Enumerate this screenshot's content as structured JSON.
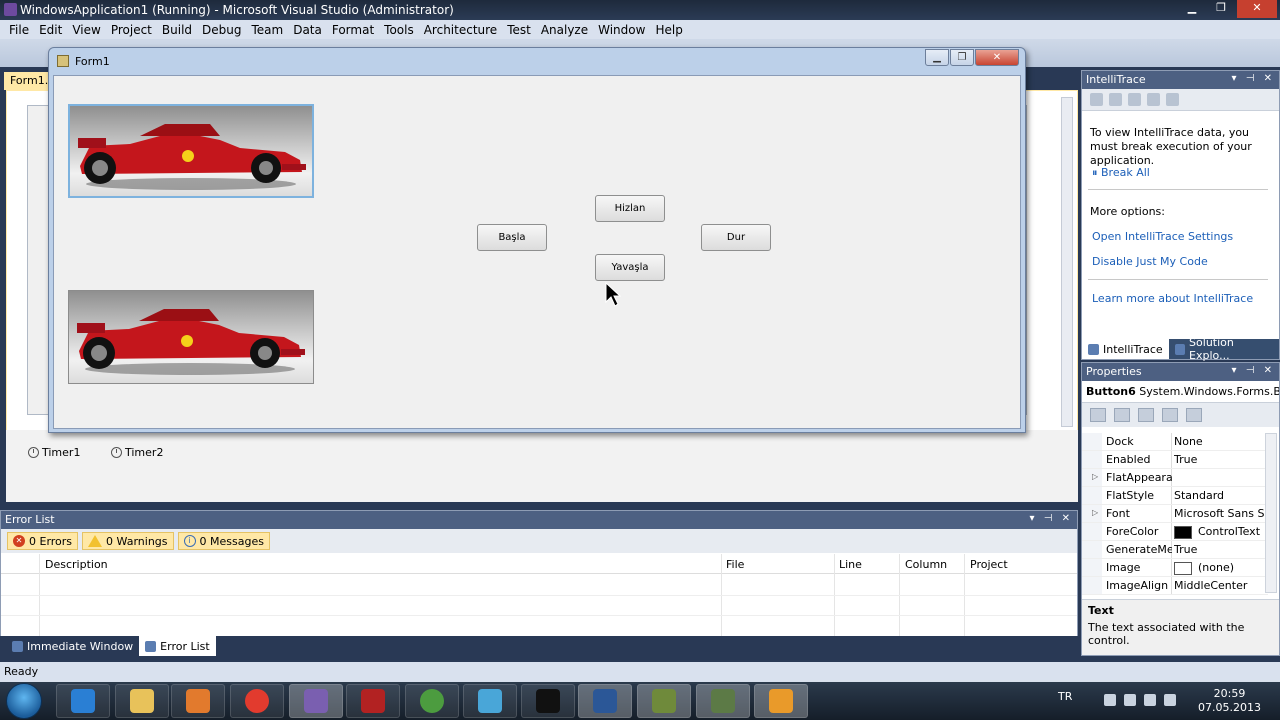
{
  "window": {
    "title": "WindowsApplication1 (Running) - Microsoft Visual Studio (Administrator)",
    "min": "▁",
    "max": "❐",
    "close": "✕"
  },
  "menu": [
    "File",
    "Edit",
    "View",
    "Project",
    "Build",
    "Debug",
    "Team",
    "Data",
    "Format",
    "Tools",
    "Architecture",
    "Test",
    "Analyze",
    "Window",
    "Help"
  ],
  "designer": {
    "doc_tab": "Form1.v",
    "tray": {
      "timer1": "Timer1",
      "timer2": "Timer2"
    }
  },
  "form1": {
    "title": "Form1",
    "buttons": {
      "basla": "Başla",
      "hizlan": "Hizlan",
      "yavasla": "Yavaşla",
      "dur": "Dur"
    },
    "picture_boxes": [
      {
        "name": "car-image-top",
        "selected": true
      },
      {
        "name": "car-image-bottom",
        "selected": false
      }
    ]
  },
  "intellitrace": {
    "title": "IntelliTrace",
    "message": "To view IntelliTrace data, you must break execution of your application.",
    "break_all": "Break All",
    "more_options": "More options:",
    "open_settings": "Open IntelliTrace Settings",
    "disable_jmc": "Disable Just My Code",
    "learn_more": "Learn more about IntelliTrace",
    "tabs": [
      "IntelliTrace",
      "Solution Explo..."
    ]
  },
  "properties": {
    "title": "Properties",
    "object_name": "Button6",
    "object_type": "System.Windows.Forms.B",
    "rows": [
      {
        "name": "Dock",
        "value": "None",
        "expandable": false
      },
      {
        "name": "Enabled",
        "value": "True",
        "expandable": false
      },
      {
        "name": "FlatAppearan",
        "value": "",
        "expandable": true
      },
      {
        "name": "FlatStyle",
        "value": "Standard",
        "expandable": false
      },
      {
        "name": "Font",
        "value": "Microsoft Sans Se",
        "expandable": true
      },
      {
        "name": "ForeColor",
        "value": "ControlText",
        "expandable": false,
        "swatch": "#000000"
      },
      {
        "name": "GenerateMer",
        "value": "True",
        "expandable": false
      },
      {
        "name": "Image",
        "value": "(none)",
        "expandable": false,
        "swatch": "#ffffff"
      },
      {
        "name": "ImageAlign",
        "value": "MiddleCenter",
        "expandable": false
      }
    ],
    "desc_title": "Text",
    "desc_text": "The text associated with the control."
  },
  "error_list": {
    "title": "Error List",
    "filters": {
      "errors": "0 Errors",
      "warnings": "0 Warnings",
      "messages": "0 Messages"
    },
    "columns": [
      "Description",
      "File",
      "Line",
      "Column",
      "Project"
    ]
  },
  "bottom_tabs": [
    "Immediate Window",
    "Error List"
  ],
  "status": "Ready",
  "taskbar": {
    "lang": "TR",
    "time": "20:59",
    "date": "07.05.2013"
  },
  "colors": {
    "accent": "#ffe8a6",
    "panel_header": "#4d6082",
    "ide_background": "#293955",
    "link": "#1c5fb8"
  }
}
